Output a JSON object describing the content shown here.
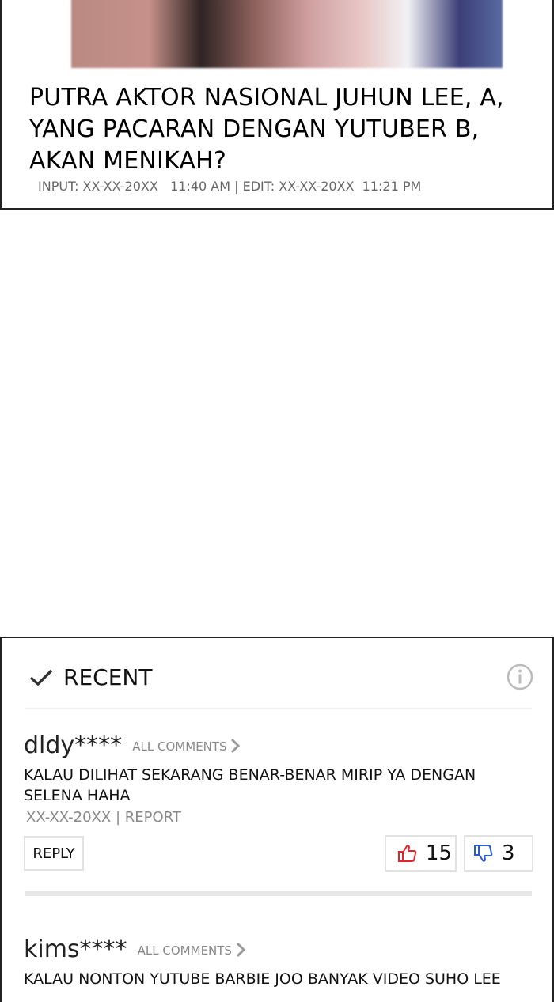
{
  "article": {
    "title": "PUTRA AKTOR NASIONAL JUHUN LEE, A, YANG PACARAN DENGAN YUTUBER B, AKAN MENIKAH?",
    "meta": "INPUT: XX-XX-20XX   11:40 AM | EDIT: XX-XX-20XX  11:21 PM"
  },
  "comments_section": {
    "header_label": "RECENT",
    "header_icon": "check-icon",
    "info_icon": "info-icon",
    "comments": [
      {
        "username": "dldy****",
        "all_comments_label": "ALL COMMENTS",
        "text": "KALAU DILIHAT SEKARANG BENAR-BENAR MIRIP YA DENGAN SELENA HAHA",
        "date": "XX-XX-20XX",
        "report_label": "REPORT",
        "reply_label": "REPLY",
        "likes": "15",
        "dislikes": "3"
      },
      {
        "username": "kims****",
        "all_comments_label": "ALL COMMENTS",
        "text": "KALAU NONTON YUTUBE BARBIE JOO BANYAK VIDEO SUHO LEE"
      }
    ]
  },
  "colors": {
    "like_icon": "#e0262b",
    "dislike_icon": "#2a5bd7",
    "border": "#222222",
    "muted_text": "#888888"
  }
}
